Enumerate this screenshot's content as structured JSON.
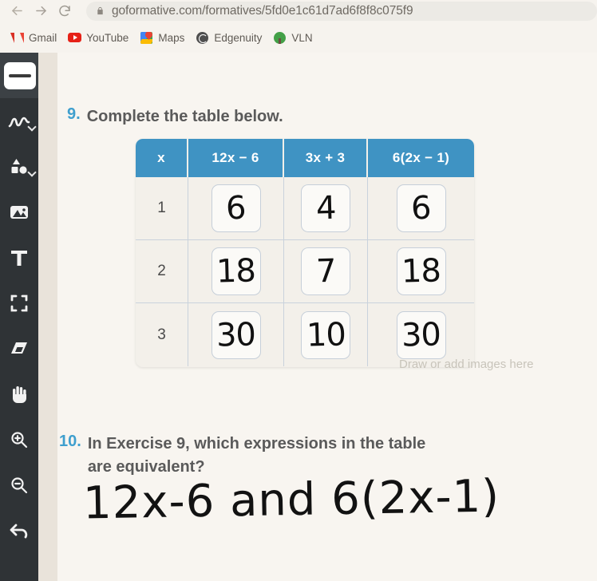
{
  "browser": {
    "back_label": "Back",
    "forward_label": "Forward",
    "reload_label": "Reload",
    "url": "goformative.com/formatives/5fd0e1c61d7ad6f8f8c075f9",
    "bookmarks": [
      {
        "label": "Gmail",
        "icon": "gmail-icon"
      },
      {
        "label": "YouTube",
        "icon": "youtube-icon"
      },
      {
        "label": "Maps",
        "icon": "maps-icon"
      },
      {
        "label": "Edgenuity",
        "icon": "edgenuity-icon"
      },
      {
        "label": "VLN",
        "icon": "vln-icon"
      }
    ]
  },
  "toolbar": {
    "tools": [
      {
        "name": "stroke-width-tool",
        "active": true,
        "has_chevron": false
      },
      {
        "name": "pen-draw-tool",
        "active": false,
        "has_chevron": true
      },
      {
        "name": "shapes-tool",
        "active": false,
        "has_chevron": true
      },
      {
        "name": "image-tool",
        "active": false,
        "has_chevron": false
      },
      {
        "name": "text-tool",
        "active": false,
        "has_chevron": false
      },
      {
        "name": "crop-tool",
        "active": false,
        "has_chevron": false
      },
      {
        "name": "eraser-tool",
        "active": false,
        "has_chevron": false
      },
      {
        "name": "pan-hand-tool",
        "active": false,
        "has_chevron": false
      },
      {
        "name": "zoom-in-tool",
        "active": false,
        "has_chevron": false
      },
      {
        "name": "zoom-out-tool",
        "active": false,
        "has_chevron": false
      },
      {
        "name": "undo-tool",
        "active": false,
        "has_chevron": false
      }
    ]
  },
  "worksheet": {
    "question9": {
      "number": "9.",
      "text": "Complete the table below."
    },
    "question10": {
      "number": "10.",
      "text": "In Exercise 9, which expressions in the table are equivalent?",
      "handwritten_answer": "12x-6 and 6(2x-1)"
    },
    "table": {
      "headers": [
        "x",
        "12x − 6",
        "3x + 3",
        "6(2x − 1)"
      ],
      "rows": [
        {
          "x": "1",
          "answers": [
            "6",
            "4",
            "6"
          ]
        },
        {
          "x": "2",
          "answers": [
            "18",
            "7",
            "18"
          ]
        },
        {
          "x": "3",
          "answers": [
            "30",
            "10",
            "30"
          ]
        }
      ],
      "header_color": "#3f93c3"
    },
    "canvas_placeholder": "Draw or add images here"
  }
}
